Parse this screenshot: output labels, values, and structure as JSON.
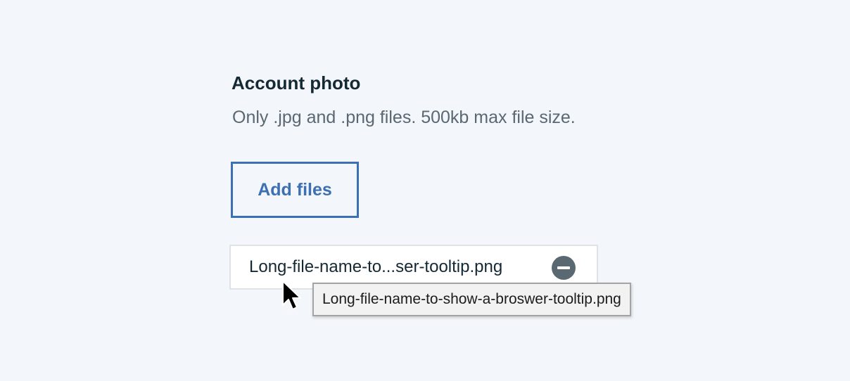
{
  "field": {
    "label": "Account photo",
    "helper_text": "Only .jpg and .png files. 500kb max file size."
  },
  "upload": {
    "button_label": "Add files"
  },
  "file": {
    "display_name": "Long-file-name-to...ser-tooltip.png",
    "full_name": "Long-file-name-to-show-a-broswer-tooltip.png",
    "remove_icon": "minus-circle-icon"
  },
  "tooltip": {
    "text": "Long-file-name-to-show-a-broswer-tooltip.png"
  },
  "colors": {
    "background": "#f3f6fa",
    "accent": "#3d70b2",
    "text_primary": "#152935",
    "text_secondary": "#5a6872",
    "remove_icon": "#5a6872"
  }
}
